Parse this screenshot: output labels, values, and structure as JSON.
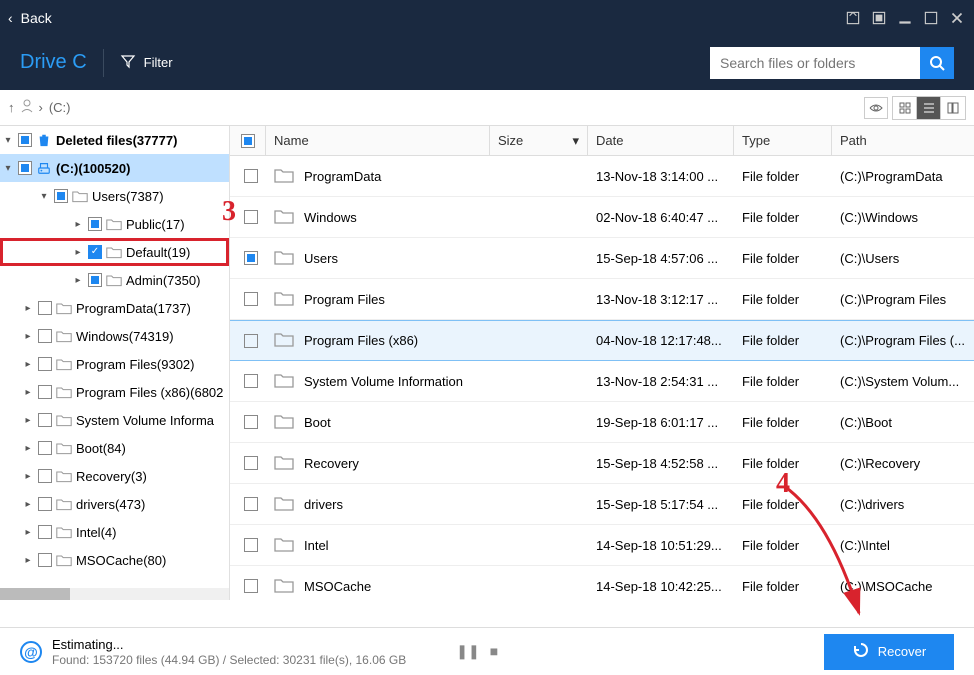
{
  "header": {
    "back_label": "Back",
    "drive_label": "Drive C",
    "filter_label": "Filter",
    "search_placeholder": "Search files or folders"
  },
  "breadcrumb": {
    "path": "(C:)"
  },
  "tree": {
    "deleted_label": "Deleted files(37777)",
    "drive_label": "(C:)(100520)",
    "items": [
      {
        "label": "Users(7387)",
        "indent": 38,
        "expanded": true,
        "check": "ind"
      },
      {
        "label": "Public(17)",
        "indent": 72,
        "expanded": false,
        "check": "ind"
      },
      {
        "label": "Default(19)",
        "indent": 72,
        "expanded": false,
        "check": "checked",
        "hi": true
      },
      {
        "label": "Admin(7350)",
        "indent": 72,
        "expanded": false,
        "check": "ind"
      },
      {
        "label": "ProgramData(1737)",
        "indent": 22,
        "expanded": false,
        "check": ""
      },
      {
        "label": "Windows(74319)",
        "indent": 22,
        "expanded": false,
        "check": ""
      },
      {
        "label": "Program Files(9302)",
        "indent": 22,
        "expanded": false,
        "check": ""
      },
      {
        "label": "Program Files (x86)(6802",
        "indent": 22,
        "expanded": false,
        "check": ""
      },
      {
        "label": "System Volume Informa",
        "indent": 22,
        "expanded": false,
        "check": ""
      },
      {
        "label": "Boot(84)",
        "indent": 22,
        "expanded": false,
        "check": ""
      },
      {
        "label": "Recovery(3)",
        "indent": 22,
        "expanded": false,
        "check": ""
      },
      {
        "label": "drivers(473)",
        "indent": 22,
        "expanded": false,
        "check": ""
      },
      {
        "label": "Intel(4)",
        "indent": 22,
        "expanded": false,
        "check": ""
      },
      {
        "label": "MSOCache(80)",
        "indent": 22,
        "expanded": false,
        "check": ""
      }
    ]
  },
  "file_header": {
    "name": "Name",
    "size": "Size",
    "date": "Date",
    "type": "Type",
    "path": "Path"
  },
  "files": [
    {
      "name": "ProgramData",
      "date": "13-Nov-18 3:14:00 ...",
      "type": "File folder",
      "path": "(C:)\\ProgramData",
      "hl": false,
      "check": ""
    },
    {
      "name": "Windows",
      "date": "02-Nov-18 6:40:47 ...",
      "type": "File folder",
      "path": "(C:)\\Windows",
      "hl": false,
      "check": ""
    },
    {
      "name": "Users",
      "date": "15-Sep-18 4:57:06 ...",
      "type": "File folder",
      "path": "(C:)\\Users",
      "hl": false,
      "check": "ind"
    },
    {
      "name": "Program Files",
      "date": "13-Nov-18 3:12:17 ...",
      "type": "File folder",
      "path": "(C:)\\Program Files",
      "hl": false,
      "check": ""
    },
    {
      "name": "Program Files (x86)",
      "date": "04-Nov-18 12:17:48...",
      "type": "File folder",
      "path": "(C:)\\Program Files (...",
      "hl": true,
      "check": ""
    },
    {
      "name": "System Volume Information",
      "date": "13-Nov-18 2:54:31 ...",
      "type": "File folder",
      "path": "(C:)\\System Volum...",
      "hl": false,
      "check": ""
    },
    {
      "name": "Boot",
      "date": "19-Sep-18 6:01:17 ...",
      "type": "File folder",
      "path": "(C:)\\Boot",
      "hl": false,
      "check": ""
    },
    {
      "name": "Recovery",
      "date": "15-Sep-18 4:52:58 ...",
      "type": "File folder",
      "path": "(C:)\\Recovery",
      "hl": false,
      "check": ""
    },
    {
      "name": "drivers",
      "date": "15-Sep-18 5:17:54 ...",
      "type": "File folder",
      "path": "(C:)\\drivers",
      "hl": false,
      "check": ""
    },
    {
      "name": "Intel",
      "date": "14-Sep-18 10:51:29...",
      "type": "File folder",
      "path": "(C:)\\Intel",
      "hl": false,
      "check": ""
    },
    {
      "name": "MSOCache",
      "date": "14-Sep-18 10:42:25...",
      "type": "File folder",
      "path": "(C:)\\MSOCache",
      "hl": false,
      "check": ""
    }
  ],
  "status": {
    "estimating": "Estimating...",
    "found": "Found: 153720 files (44.94 GB) / Selected: 30231 file(s), 16.06 GB",
    "recover_label": "Recover"
  },
  "annotations": {
    "step3": "3",
    "step4": "4"
  }
}
